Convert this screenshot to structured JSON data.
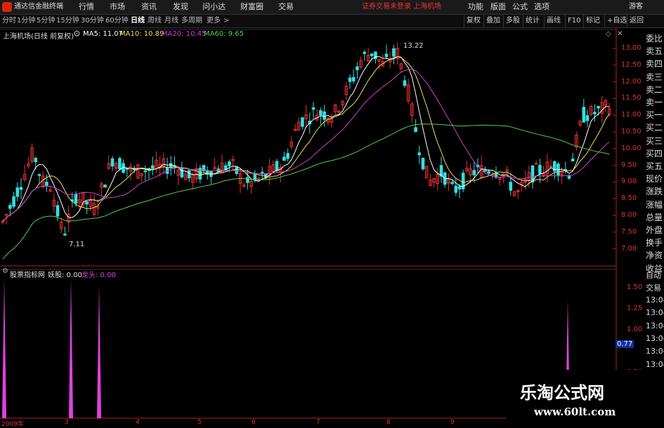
{
  "menubar": {
    "app_title": "通达信金融终端",
    "items": [
      "行情",
      "市场",
      "资讯",
      "发现",
      "问小达",
      "财富圈",
      "交易"
    ],
    "notice": "证券交易未登录",
    "stock_name": "上海机场",
    "right_items": [
      "功能",
      "版面",
      "公式",
      "选项"
    ],
    "guest": "游客",
    "colors": {
      "notice": "#e33333",
      "bar_bg": "#1a1a1a"
    }
  },
  "periodbar": {
    "periods": [
      "分时",
      "1分钟",
      "5分钟",
      "15分钟",
      "30分钟",
      "60分钟",
      "日线",
      "周线",
      "月线",
      "多周期",
      "更多"
    ],
    "active": "日线",
    "tools": [
      "复权",
      "叠加",
      "多股",
      "统计",
      "画线",
      "F10",
      "标记",
      "+自选",
      "返回"
    ]
  },
  "chart": {
    "title": "上海机场(日线 前复权)",
    "ma": [
      {
        "label": "MA5: 11.07",
        "color": "#ffffff"
      },
      {
        "label": "MA10: 10.89",
        "color": "#e8e060"
      },
      {
        "label": "MA20: 10.45",
        "color": "#d040d0"
      },
      {
        "label": "MA60: 9.65",
        "color": "#50d050"
      }
    ],
    "high_label": "13.22",
    "low_label": "7.11",
    "price_ticks": [
      "13.00",
      "12.50",
      "12.00",
      "11.50",
      "11.00",
      "10.50",
      "10.00",
      "9.50",
      "9.00",
      "8.50",
      "8.00",
      "7.50",
      "7.00"
    ],
    "indicator_title": "股票指标网",
    "indicator_values": [
      "妖股: 0.00",
      "龙头: 0.00"
    ],
    "indicator_ticks": [
      "1.50",
      "1.25",
      "1.00",
      "0.77",
      "0.50",
      "0.25"
    ],
    "date_labels": [
      "2009年",
      "3",
      "4",
      "5",
      "6",
      "7",
      "8",
      "9"
    ],
    "colors": {
      "up": "#e83030",
      "down": "#30e0e0",
      "indicator": "#e040e0",
      "axis": "#b02020"
    }
  },
  "right_panel": {
    "items": [
      "委比",
      "卖五",
      "卖四",
      "卖三",
      "卖二",
      "卖一",
      "买一",
      "买二",
      "买三",
      "买四",
      "买五",
      "现价",
      "涨跌",
      "涨幅",
      "总量",
      "外盘",
      "换手",
      "净资",
      "收益",
      "自动",
      "交易",
      "13:04",
      "13:04",
      "13:04",
      "13:04",
      "13:04",
      "13:04"
    ]
  },
  "watermark": {
    "title": "乐淘公式网",
    "url": "www.60lt.com"
  }
}
